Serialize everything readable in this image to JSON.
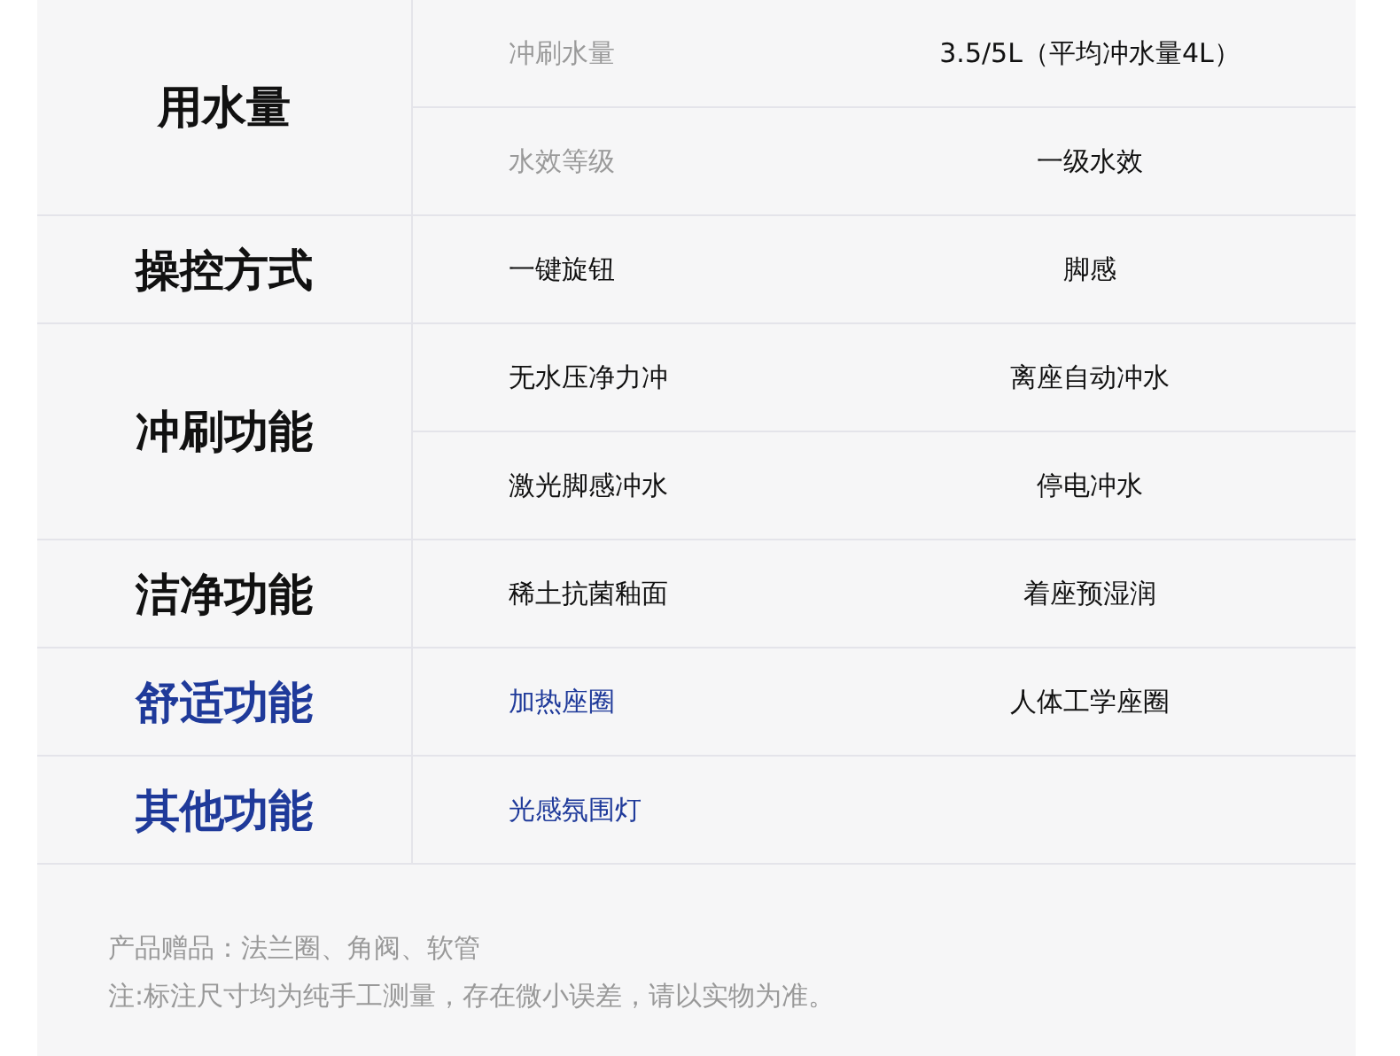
{
  "groups": [
    {
      "category": "用水量",
      "color": "#111111",
      "rows": [
        {
          "cells": [
            {
              "text": "冲刷水量",
              "color": "#9a9a9a"
            },
            {
              "text": "3.5/5L（平均冲水量4L）",
              "color": "#111111"
            }
          ]
        },
        {
          "cells": [
            {
              "text": "水效等级",
              "color": "#9a9a9a"
            },
            {
              "text": "一级水效",
              "color": "#111111"
            }
          ]
        }
      ]
    },
    {
      "category": "操控方式",
      "color": "#111111",
      "rows": [
        {
          "cells": [
            {
              "text": "一键旋钮",
              "color": "#111111"
            },
            {
              "text": "脚感",
              "color": "#111111"
            }
          ]
        }
      ]
    },
    {
      "category": "冲刷功能",
      "color": "#111111",
      "rows": [
        {
          "cells": [
            {
              "text": "无水压净力冲",
              "color": "#111111"
            },
            {
              "text": "离座自动冲水",
              "color": "#111111"
            }
          ]
        },
        {
          "cells": [
            {
              "text": "激光脚感冲水",
              "color": "#111111"
            },
            {
              "text": "停电冲水",
              "color": "#111111"
            }
          ]
        }
      ]
    },
    {
      "category": "洁净功能",
      "color": "#111111",
      "rows": [
        {
          "cells": [
            {
              "text": "稀土抗菌釉面",
              "color": "#111111"
            },
            {
              "text": "着座预湿润",
              "color": "#111111"
            }
          ]
        }
      ]
    },
    {
      "category": "舒适功能",
      "color": "#1f3a9a",
      "rows": [
        {
          "cells": [
            {
              "text": "加热座圈",
              "color": "#1f3a9a"
            },
            {
              "text": "人体工学座圈",
              "color": "#111111"
            }
          ]
        }
      ]
    },
    {
      "category": "其他功能",
      "color": "#1f3a9a",
      "rows": [
        {
          "cells": [
            {
              "text": "光感氛围灯",
              "color": "#1f3a9a"
            }
          ]
        }
      ]
    }
  ],
  "notes": [
    "产品赠品：法兰圈、角阀、软管",
    "注:标注尺寸均为纯手工测量，存在微小误差，请以实物为准。"
  ]
}
